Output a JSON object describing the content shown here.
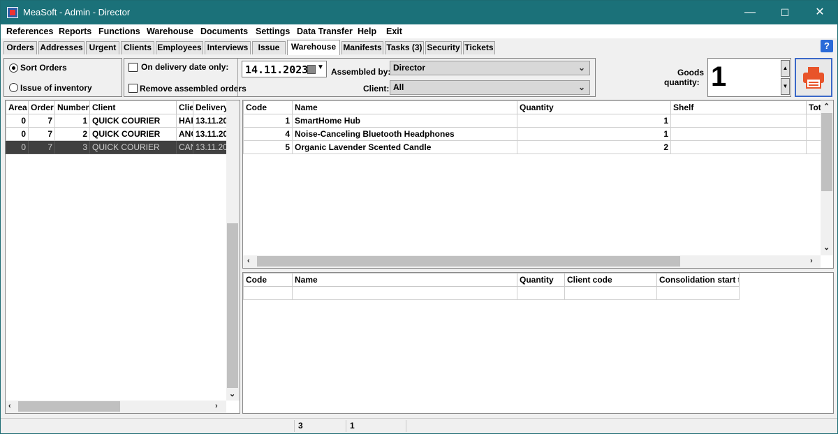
{
  "window": {
    "title": "MeaSoft - Admin - Director",
    "minimize": "—",
    "maximize": "☐",
    "close": "✕"
  },
  "menu": [
    "References",
    "Reports",
    "Functions",
    "Warehouse",
    "Documents",
    "Settings",
    "Data Transfer",
    "Help",
    "Exit"
  ],
  "tabs": [
    "Orders",
    "Addresses",
    "Urgent",
    "Clients",
    "Employees",
    "Interviews",
    "Issue",
    "Warehouse",
    "Manifests",
    "Tasks (3)",
    "Security",
    "Tickets"
  ],
  "active_tab": "Warehouse",
  "help_label": "?",
  "mode": {
    "sort_orders": "Sort Orders",
    "issue_inventory": "Issue of inventory",
    "selected": "sort_orders"
  },
  "filters": {
    "delivery_date_only": "On delivery date only:",
    "delivery_date_only_checked": false,
    "remove_assembled": "Remove assembled orders",
    "remove_assembled_checked": false,
    "date": "14.11.2023",
    "assembled_by_label": "Assembled by:",
    "assembled_by": "Director",
    "client_label": "Client:",
    "client": "All"
  },
  "goods": {
    "label_line1": "Goods",
    "label_line2": "quantity:",
    "value": "1"
  },
  "orders_table": {
    "headers": [
      "Area",
      "Order",
      "Number",
      "Client",
      "Clie",
      "Delivery"
    ],
    "rows": [
      [
        "0",
        "7",
        "1",
        "QUICK COURIER",
        "HAR",
        "13.11.20"
      ],
      [
        "0",
        "7",
        "2",
        "QUICK COURIER",
        "ANG",
        "13.11.20"
      ],
      [
        "0",
        "7",
        "3",
        "QUICK COURIER",
        "CAN",
        "13.11.20"
      ]
    ],
    "selected_row": 2
  },
  "items_table": {
    "headers": [
      "Code",
      "Name",
      "Quantity",
      "Shelf",
      "Tot"
    ],
    "rows": [
      [
        "1",
        "SmartHome Hub",
        "1",
        "",
        ""
      ],
      [
        "4",
        "Noise-Canceling Bluetooth Headphones",
        "1",
        "",
        ""
      ],
      [
        "5",
        "Organic Lavender Scented Candle",
        "2",
        "",
        ""
      ]
    ]
  },
  "consolidation_table": {
    "headers": [
      "Code",
      "Name",
      "Quantity",
      "Client code",
      "Consolidation start ti"
    ]
  },
  "status": {
    "count": "3",
    "value": "1"
  },
  "colors": {
    "titlebar": "#1b7179",
    "selected_row": "#404040",
    "print_icon": "#e8542a"
  }
}
